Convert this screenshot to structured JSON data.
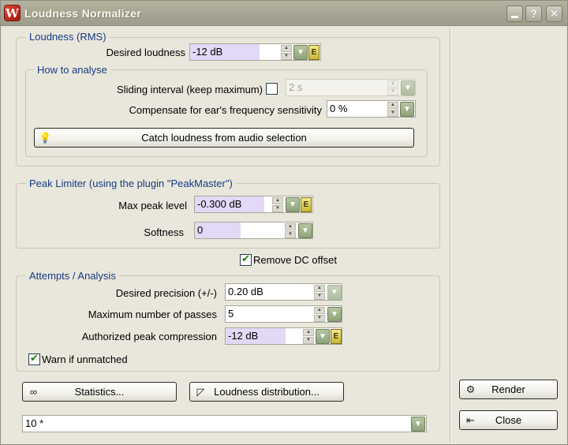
{
  "window": {
    "title": "Loudness Normalizer"
  },
  "titlebar": {
    "help_label": "?",
    "close_label": "✕"
  },
  "loudness": {
    "legend": "Loudness (RMS)",
    "desired_label": "Desired loudness",
    "desired_value": "-12 dB"
  },
  "analyse": {
    "legend": "How to analyse",
    "sliding_label": "Sliding interval (keep maximum)",
    "sliding_checked": false,
    "sliding_value": "2 s",
    "compensate_label": "Compensate for ear's frequency sensitivity",
    "compensate_value": "0 %",
    "catch_button": "Catch loudness from audio selection"
  },
  "limiter": {
    "legend": "Peak Limiter (using the plugin \"PeakMaster\")",
    "max_peak_label": "Max peak level",
    "max_peak_value": "-0.300 dB",
    "softness_label": "Softness",
    "softness_value": "0"
  },
  "remove_dc": {
    "label": "Remove DC offset",
    "checked": true
  },
  "attempts": {
    "legend": "Attempts / Analysis",
    "precision_label": "Desired precision (+/-)",
    "precision_value": "0.20 dB",
    "passes_label": "Maximum number of passes",
    "passes_value": "5",
    "compression_label": "Authorized peak compression",
    "compression_value": "-12 dB",
    "warn_label": "Warn if unmatched",
    "warn_checked": true
  },
  "buttons": {
    "statistics": "Statistics...",
    "distribution": "Loudness distribution...",
    "render": "Render",
    "close": "Close"
  },
  "preset": {
    "value": "10 *"
  },
  "colors": {
    "legend_text": "#173a83",
    "highlight": "#e3d9f7",
    "dropdown_green": "#8ea27a"
  }
}
